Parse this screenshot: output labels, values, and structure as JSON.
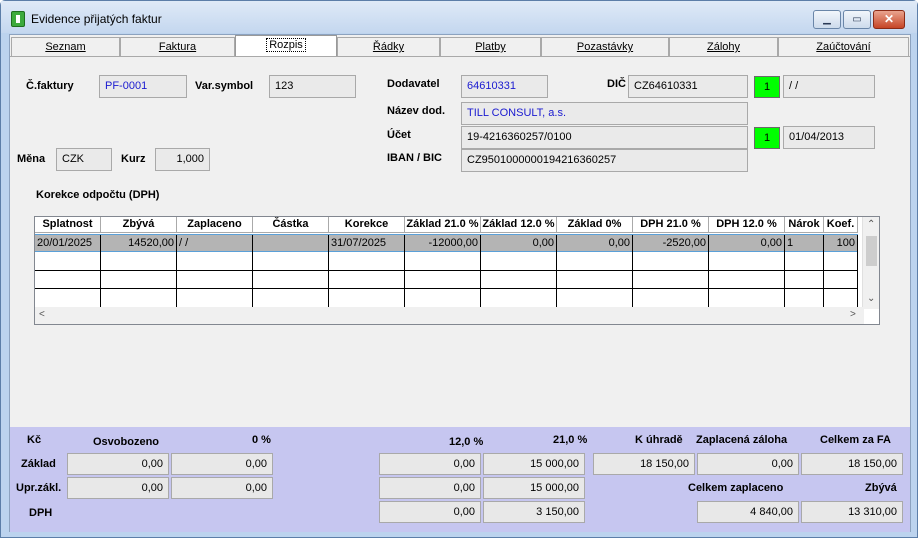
{
  "window": {
    "title": "Evidence přijatých faktur"
  },
  "tabs": [
    "Seznam",
    "Faktura",
    "Rozpis",
    "Řádky",
    "Platby",
    "Pozastávky",
    "Zálohy",
    "Zaúčtování"
  ],
  "header": {
    "cislo_faktury_label": "Č.faktury",
    "cislo_faktury": "PF-0001",
    "var_symbol_label": "Var.symbol",
    "var_symbol": "123",
    "mena_label": "Měna",
    "mena": "CZK",
    "kurz_label": "Kurz",
    "kurz": "1,000",
    "dodavatel_label": "Dodavatel",
    "dodavatel": "64610331",
    "dic_label": "DIČ",
    "dic": "CZ64610331",
    "dic_flag": "1",
    "dic_date": " /  /",
    "nazev_label": "Název dod.",
    "nazev": "TILL CONSULT, a.s.",
    "ucet_label": "Účet",
    "ucet": "19-4216360257/0100",
    "ucet_flag": "1",
    "ucet_date": "01/04/2013",
    "iban_label": "IBAN / BIC",
    "iban": "CZ9501000000194216360257"
  },
  "grid": {
    "caption": "Korekce odpočtu (DPH)",
    "columns": [
      "Splatnost",
      "Zbývá",
      "Zaplaceno",
      "Částka",
      "Korekce",
      "Základ 21.0 %",
      "Základ 12.0 %",
      "Základ 0%",
      "DPH 21.0 %",
      "DPH 12.0 %",
      "Nárok",
      "Koef."
    ],
    "rows": [
      [
        "20/01/2025",
        "14520,00",
        " /  /",
        "",
        "31/07/2025",
        "-12000,00",
        "0,00",
        "0,00",
        "-2520,00",
        "0,00",
        "1",
        "100"
      ]
    ]
  },
  "summary": {
    "kc_label": "Kč",
    "osvobozeno_label": "Osvobozeno",
    "p0_label": "0 %",
    "p12_label": "12,0 %",
    "p21_label": "21,0 %",
    "k_uhrade_label": "K úhradě",
    "zaplacena_zaloha_label": "Zaplacená záloha",
    "celkem_za_fa_label": "Celkem za FA",
    "zaklad_label": "Základ",
    "upr_zakl_label": "Upr.zákl.",
    "dph_label": "DPH",
    "zaklad_osv": "0,00",
    "zaklad_0": "0,00",
    "zaklad_12": "0,00",
    "zaklad_21": "15 000,00",
    "upr_osv": "0,00",
    "upr_0": "0,00",
    "upr_12": "0,00",
    "upr_21": "15 000,00",
    "dph_12": "0,00",
    "dph_21": "3 150,00",
    "k_uhrade": "18 150,00",
    "zaplacena_zaloha": "0,00",
    "celkem_za_fa": "18 150,00",
    "celkem_zaplaceno_label": "Celkem zaplaceno",
    "zbyva_label": "Zbývá",
    "celkem_zaplaceno": "4 840,00",
    "zbyva": "13 310,00"
  }
}
